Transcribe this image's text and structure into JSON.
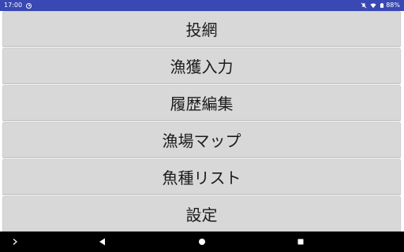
{
  "status_bar": {
    "time": "17:00",
    "battery_percent": "88%",
    "notification_icon": "app-notification-icon",
    "icons": [
      "mute-icon",
      "wifi-icon",
      "battery-icon"
    ]
  },
  "menu": {
    "items": [
      {
        "label": "投網"
      },
      {
        "label": "漁獲入力"
      },
      {
        "label": "履歴編集"
      },
      {
        "label": "漁場マップ"
      },
      {
        "label": "魚種リスト"
      },
      {
        "label": "設定"
      }
    ]
  },
  "nav_bar": {
    "buttons": [
      "expand-icon",
      "back-icon",
      "home-icon",
      "recents-icon"
    ]
  },
  "colors": {
    "status_bar": "#3948b2",
    "button_bg": "#d8d8d8",
    "nav_bar": "#000000"
  }
}
